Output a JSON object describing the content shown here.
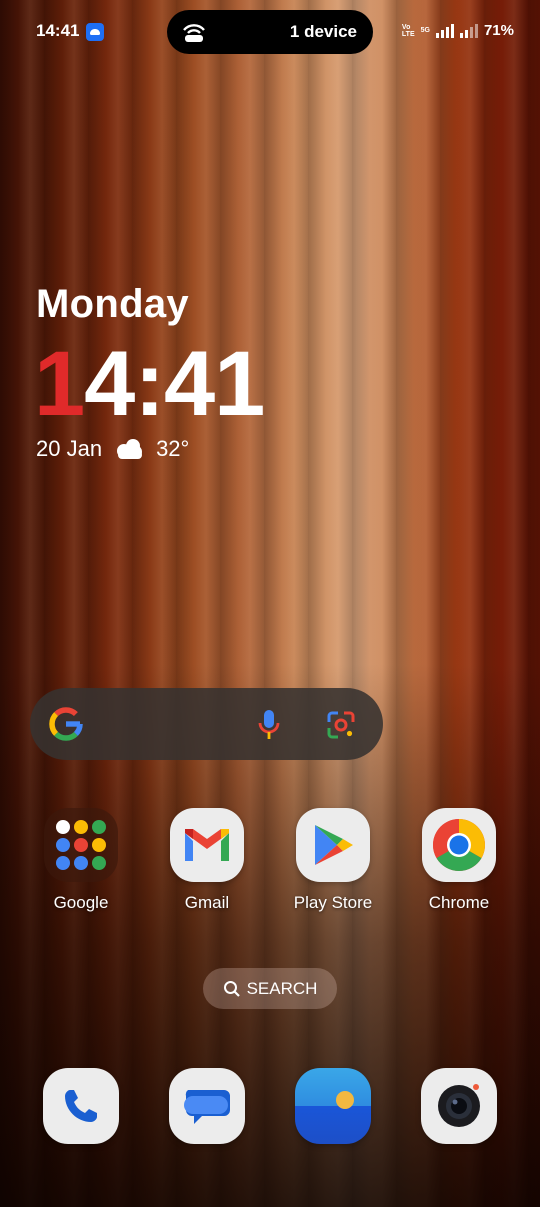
{
  "status_bar": {
    "time": "14:41",
    "hotspot_label": "1 device",
    "volte_tag_1": "Vo",
    "volte_tag_2": "LTE",
    "network_5g": "5G",
    "battery": "71%"
  },
  "clock_widget": {
    "day": "Monday",
    "time_first": "1",
    "time_rest": "4:41",
    "date": "20 Jan",
    "temperature": "32°"
  },
  "apps": [
    {
      "label": "Google",
      "icon": "google-folder-icon"
    },
    {
      "label": "Gmail",
      "icon": "gmail-icon"
    },
    {
      "label": "Play Store",
      "icon": "play-store-icon"
    },
    {
      "label": "Chrome",
      "icon": "chrome-icon"
    }
  ],
  "search_chip": {
    "label": "SEARCH",
    "icon": "search-icon"
  },
  "dock": [
    {
      "icon": "phone-icon"
    },
    {
      "icon": "messages-icon"
    },
    {
      "icon": "gallery-icon"
    },
    {
      "icon": "camera-icon"
    }
  ],
  "colors": {
    "clock_accent": "#e02a2a",
    "google_blue": "#4285F4",
    "google_red": "#EA4335",
    "google_yellow": "#FBBC05",
    "google_green": "#34A853"
  }
}
